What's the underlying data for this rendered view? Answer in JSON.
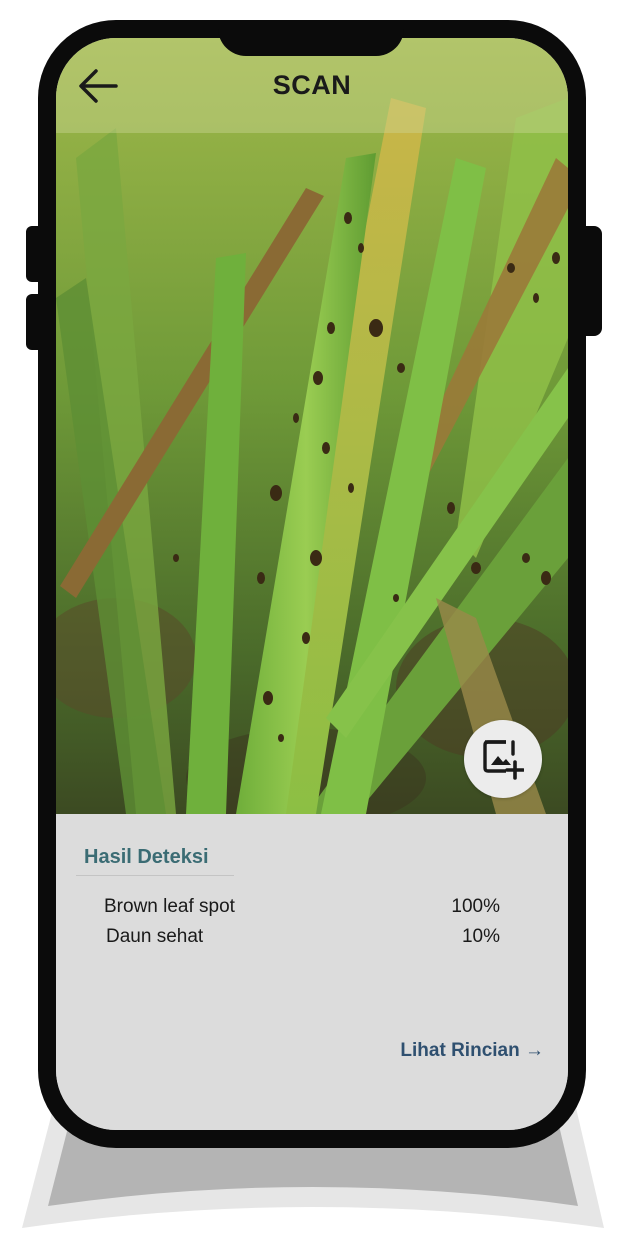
{
  "header": {
    "title": "SCAN",
    "back_icon": "arrow-left-icon"
  },
  "photo": {
    "subject": "rice leaves with brown spots",
    "add_image_icon": "add-photo-icon"
  },
  "results": {
    "title": "Hasil Deteksi",
    "items": [
      {
        "label": "Brown leaf spot",
        "value": "100%"
      },
      {
        "label": "Daun sehat",
        "value": "10%"
      }
    ],
    "detail_link": "Lihat Rincian →"
  },
  "colors": {
    "results_title": "#3b6c74",
    "detail_link": "#2f5070",
    "panel_bg": "#dcdcdc",
    "phone_frame": "#0b0b0b"
  }
}
